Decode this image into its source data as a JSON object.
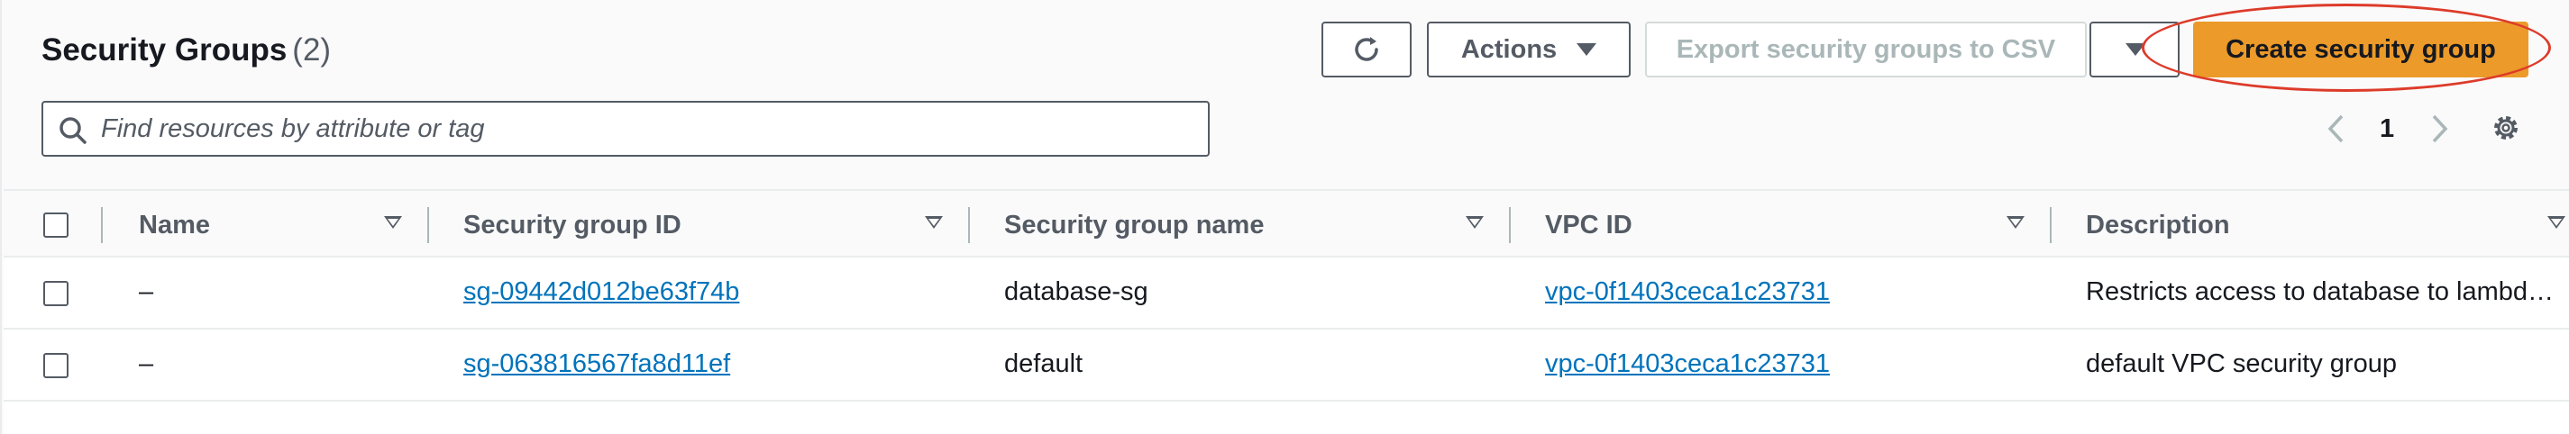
{
  "header": {
    "title": "Security Groups",
    "count": "(2)"
  },
  "toolbar": {
    "actions_label": "Actions",
    "export_label": "Export security groups to CSV",
    "create_label": "Create security group"
  },
  "search": {
    "placeholder": "Find resources by attribute or tag"
  },
  "pagination": {
    "current_page": "1"
  },
  "table": {
    "columns": [
      "Name",
      "Security group ID",
      "Security group name",
      "VPC ID",
      "Description"
    ],
    "rows": [
      {
        "name": "–",
        "sg_id": "sg-09442d012be63f74b",
        "sg_name": "database-sg",
        "vpc_id": "vpc-0f1403ceca1c23731",
        "description": "Restricts access to database to lambda…"
      },
      {
        "name": "–",
        "sg_id": "sg-063816567fa8d11ef",
        "sg_name": "default",
        "vpc_id": "vpc-0f1403ceca1c23731",
        "description": "default VPC security group"
      }
    ]
  },
  "colors": {
    "primary_button": "#ec9a2a",
    "link": "#0073bb",
    "highlight_ring": "#dd3b2a"
  },
  "icons": {
    "refresh": "refresh-icon",
    "search": "search-icon",
    "settings": "gear-icon"
  }
}
